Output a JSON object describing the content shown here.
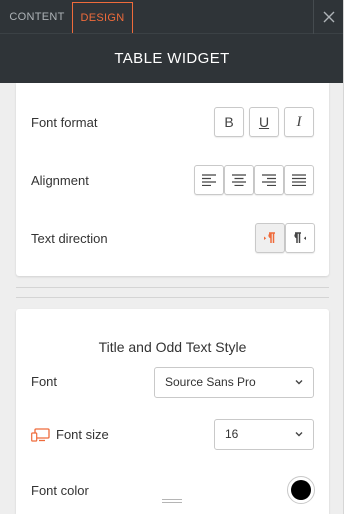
{
  "tabs": [
    {
      "label": "CONTENT"
    },
    {
      "label": "DESIGN"
    }
  ],
  "header": {
    "title": "TABLE WIDGET"
  },
  "font_section": {
    "font_format_label": "Font format",
    "bold_glyph": "B",
    "underline_glyph": "U",
    "italic_glyph": "I",
    "alignment_label": "Alignment",
    "text_direction_label": "Text direction"
  },
  "style_section": {
    "title": "Title and Odd Text Style",
    "font_label": "Font",
    "font_value": "Source Sans Pro",
    "font_size_label": "Font size",
    "font_size_value": "16",
    "font_color_label": "Font color",
    "font_color_value": "#000000"
  },
  "colors": {
    "accent": "#ef6b3b",
    "topbar": "#2f3438"
  }
}
